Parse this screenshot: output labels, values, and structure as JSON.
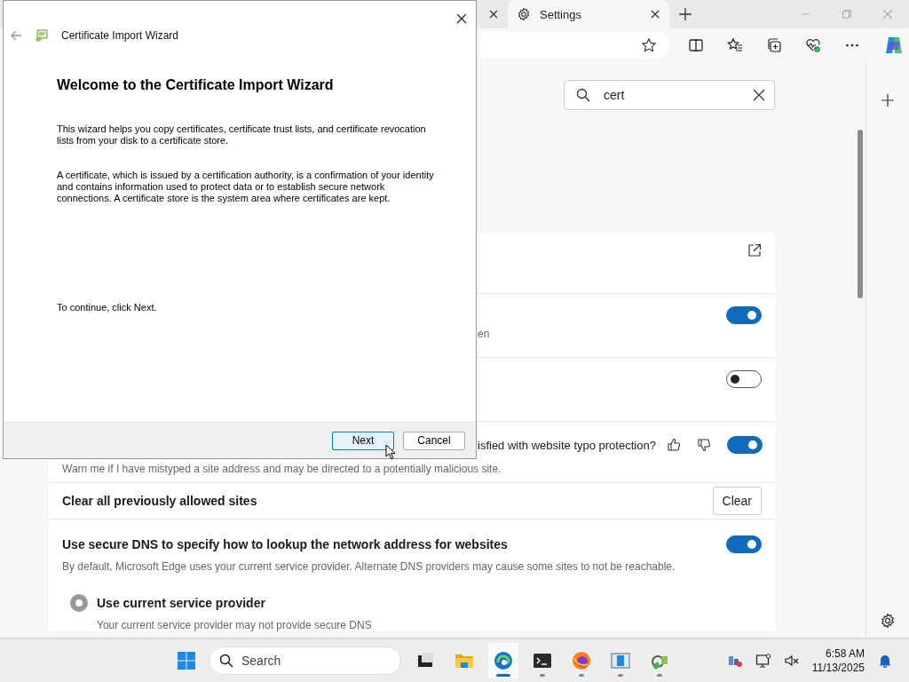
{
  "browser": {
    "tabs": [
      {
        "selected": false
      },
      {
        "label": "Settings",
        "selected": true
      }
    ],
    "settings_search": {
      "value": "cert"
    },
    "settings_rows": [
      {
        "kind": "external"
      },
      {
        "kind": "toggle",
        "description": "en",
        "on": true
      },
      {
        "kind": "toggle",
        "on": false
      },
      {
        "kind": "feedback-toggle",
        "title": "isfied with website typo protection?",
        "description": "Warn me if I have mistyped a site address and may be directed to a potentially malicious site.",
        "on": true
      },
      {
        "kind": "button",
        "title": "Clear all previously allowed sites",
        "button": "Clear"
      },
      {
        "kind": "toggle",
        "title": "Use secure DNS to specify how to lookup the network address for websites",
        "description": "By default, Microsoft Edge uses your current service provider. Alternate DNS providers may cause some sites to not be reachable.",
        "on": true
      },
      {
        "kind": "radio",
        "title": "Use current service provider",
        "description": "Your current service provider may not provide secure DNS",
        "selected": true,
        "disabled": true
      }
    ]
  },
  "dialog": {
    "title": "Certificate Import Wizard",
    "heading": "Welcome to the Certificate Import Wizard",
    "paragraphs": [
      "This wizard helps you copy certificates, certificate trust lists, and certificate revocation lists from your disk to a certificate store.",
      "A certificate, which is issued by a certification authority, is a confirmation of your identity and contains information used to protect data or to establish secure network connections. A certificate store is the system area where certificates are kept."
    ],
    "instruction": "To continue, click Next.",
    "buttons": [
      {
        "label": "Next",
        "default": true
      },
      {
        "label": "Cancel",
        "default": false
      }
    ]
  },
  "taskbar": {
    "search": {
      "placeholder": "Search"
    },
    "apps": [
      {
        "kind": "taskview",
        "running": false,
        "selected": false
      },
      {
        "kind": "folder",
        "running": false,
        "selected": false
      },
      {
        "kind": "edge",
        "running": true,
        "selected": true
      },
      {
        "kind": "terminal",
        "running": true,
        "selected": false
      },
      {
        "kind": "firefox",
        "running": true,
        "selected": false
      },
      {
        "kind": "window",
        "running": true,
        "selected": false
      },
      {
        "kind": "certmgr",
        "running": true,
        "selected": false
      }
    ],
    "time": "6:58 AM",
    "date": "11/13/2025"
  }
}
